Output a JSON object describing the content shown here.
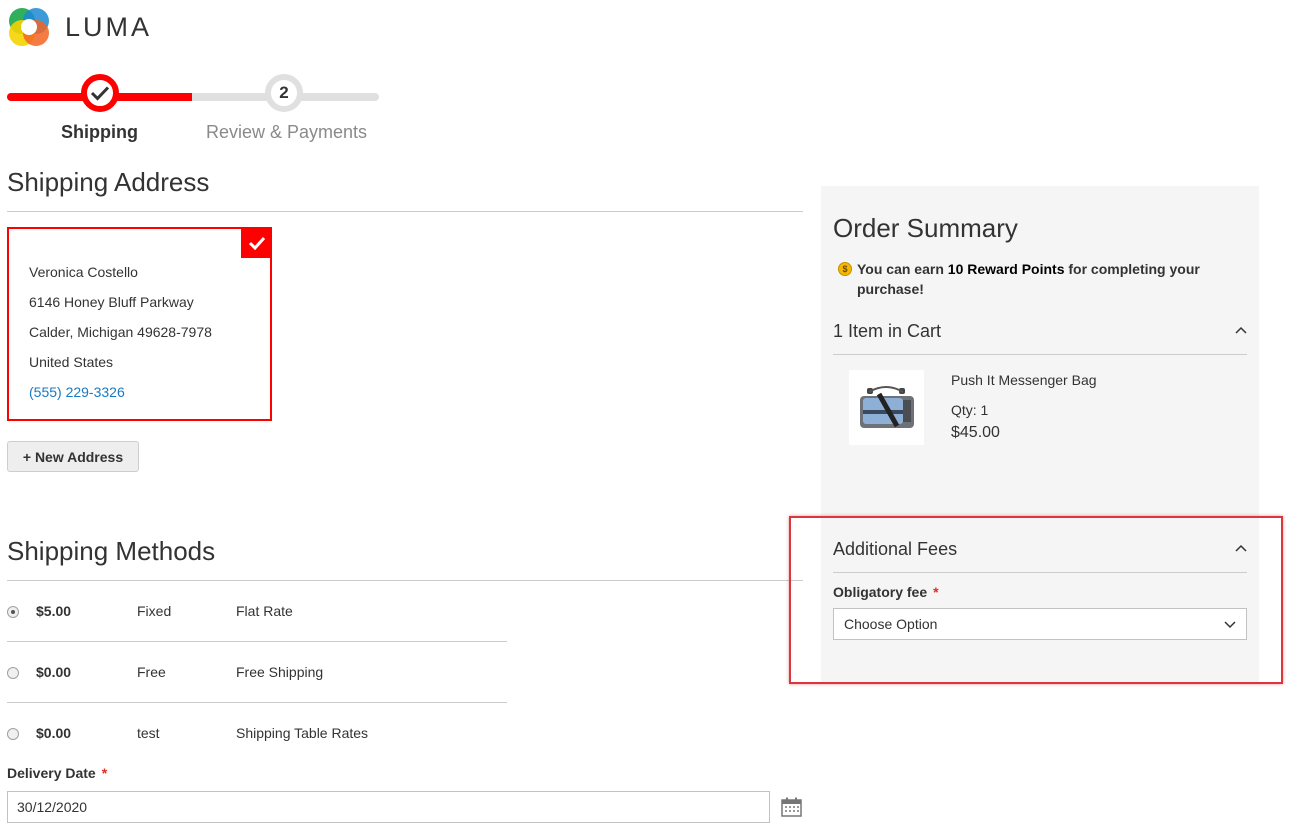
{
  "brand": {
    "name": "LUMA"
  },
  "progress": {
    "steps": [
      {
        "number": "1",
        "label": "Shipping",
        "state": "complete"
      },
      {
        "number": "2",
        "label": "Review & Payments",
        "state": "pending"
      }
    ]
  },
  "shipping_address": {
    "title": "Shipping Address",
    "selected_address": {
      "name": "Veronica Costello",
      "street": "6146 Honey Bluff Parkway",
      "city_line": "Calder, Michigan 49628-7978",
      "country": "United States",
      "phone": "(555) 229-3326"
    },
    "new_address_label": "+ New Address"
  },
  "shipping_methods": {
    "title": "Shipping Methods",
    "rows": [
      {
        "price": "$5.00",
        "method": "Fixed",
        "carrier": "Flat Rate",
        "selected": true
      },
      {
        "price": "$0.00",
        "method": "Free",
        "carrier": "Free Shipping",
        "selected": false
      },
      {
        "price": "$0.00",
        "method": "test",
        "carrier": "Shipping Table Rates",
        "selected": false
      }
    ],
    "delivery_date": {
      "label": "Delivery Date",
      "required_mark": "*",
      "value": "30/12/2020"
    }
  },
  "order_summary": {
    "title": "Order Summary",
    "reward": {
      "prefix": "You can earn ",
      "points": "10 Reward Points",
      "suffix": " for completing your purchase!"
    },
    "cart_heading": "1 Item in Cart",
    "item": {
      "name": "Push It Messenger Bag",
      "qty": "Qty: 1",
      "price": "$45.00"
    },
    "additional_fees": {
      "heading": "Additional Fees",
      "field_label": "Obligatory fee",
      "required_mark": "*",
      "select_value": "Choose Option"
    }
  },
  "colors": {
    "accent": "#ff0000",
    "link": "#1979c3",
    "sidebar_bg": "#f5f5f5",
    "highlight": "#d9363e"
  }
}
